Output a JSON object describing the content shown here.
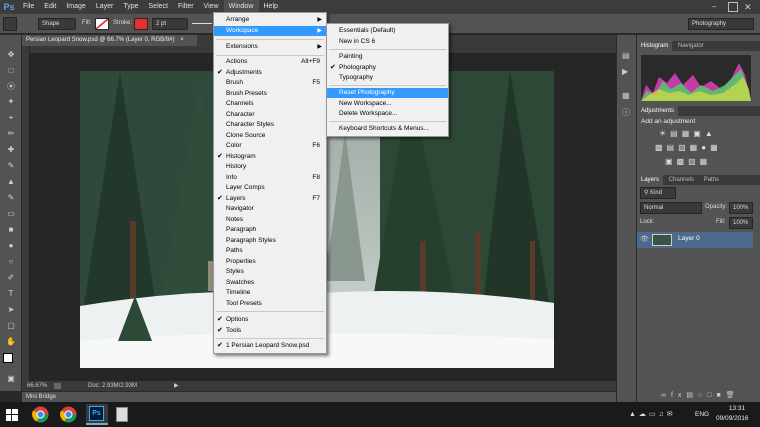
{
  "menubar": {
    "logo": "Ps",
    "items": [
      "File",
      "Edit",
      "Image",
      "Layer",
      "Type",
      "Select",
      "Filter",
      "View",
      "Window",
      "Help"
    ]
  },
  "options": {
    "shape_mode": "Shape",
    "fill_label": "Fill:",
    "stroke_label": "Stroke:",
    "stroke_size": "2 pt",
    "stroke_color": "#e63030",
    "workspace_select": "Photography"
  },
  "document": {
    "tab_title": "Persian Leopard Snow.psd @ 66.7% (Layer 0, RGB/8#)",
    "zoom": "66.67%",
    "doc_size": "Doc: 2.93M/2.93M",
    "mini_bridge": "Mini Bridge"
  },
  "window_menu": {
    "items": [
      {
        "label": "Arrange",
        "check": false,
        "shortcut": "",
        "submenu": true
      },
      {
        "label": "Workspace",
        "check": false,
        "shortcut": "",
        "submenu": true,
        "highlight": true
      },
      {
        "label": "Extensions",
        "check": false,
        "shortcut": "",
        "submenu": true
      },
      {
        "label": "Actions",
        "check": false,
        "shortcut": "Alt+F9"
      },
      {
        "label": "Adjustments",
        "check": true,
        "shortcut": ""
      },
      {
        "label": "Brush",
        "check": false,
        "shortcut": "F5"
      },
      {
        "label": "Brush Presets",
        "check": false,
        "shortcut": ""
      },
      {
        "label": "Channels",
        "check": false,
        "shortcut": ""
      },
      {
        "label": "Character",
        "check": false,
        "shortcut": ""
      },
      {
        "label": "Character Styles",
        "check": false,
        "shortcut": ""
      },
      {
        "label": "Clone Source",
        "check": false,
        "shortcut": ""
      },
      {
        "label": "Color",
        "check": false,
        "shortcut": "F6"
      },
      {
        "label": "Histogram",
        "check": true,
        "shortcut": ""
      },
      {
        "label": "History",
        "check": false,
        "shortcut": ""
      },
      {
        "label": "Info",
        "check": false,
        "shortcut": "F8"
      },
      {
        "label": "Layer Comps",
        "check": false,
        "shortcut": ""
      },
      {
        "label": "Layers",
        "check": true,
        "shortcut": "F7"
      },
      {
        "label": "Navigator",
        "check": false,
        "shortcut": ""
      },
      {
        "label": "Notes",
        "check": false,
        "shortcut": ""
      },
      {
        "label": "Paragraph",
        "check": false,
        "shortcut": ""
      },
      {
        "label": "Paragraph Styles",
        "check": false,
        "shortcut": ""
      },
      {
        "label": "Paths",
        "check": false,
        "shortcut": ""
      },
      {
        "label": "Properties",
        "check": false,
        "shortcut": ""
      },
      {
        "label": "Styles",
        "check": false,
        "shortcut": ""
      },
      {
        "label": "Swatches",
        "check": false,
        "shortcut": ""
      },
      {
        "label": "Timeline",
        "check": false,
        "shortcut": ""
      },
      {
        "label": "Tool Presets",
        "check": false,
        "shortcut": ""
      },
      {
        "label": "Options",
        "check": true,
        "shortcut": ""
      },
      {
        "label": "Tools",
        "check": true,
        "shortcut": ""
      },
      {
        "label": "1 Persian Leopard Snow.psd",
        "check": true,
        "shortcut": ""
      }
    ]
  },
  "workspace_menu": {
    "items": [
      {
        "label": "Essentials (Default)",
        "check": false
      },
      {
        "label": "New in CS 6",
        "check": false
      },
      {
        "label": "Painting",
        "check": false
      },
      {
        "label": "Photography",
        "check": true
      },
      {
        "label": "Typography",
        "check": false
      },
      {
        "label": "Reset Photography",
        "check": false,
        "highlight": true
      },
      {
        "label": "New Workspace...",
        "check": false
      },
      {
        "label": "Delete Workspace...",
        "check": false
      },
      {
        "label": "Keyboard Shortcuts & Menus...",
        "check": false
      }
    ]
  },
  "panels": {
    "histogram_tabs": [
      "Histogram",
      "Navigator"
    ],
    "adjustments_tab": "Adjustments",
    "adjustments_title": "Add an adjustment",
    "layers_tabs": [
      "Layers",
      "Channels",
      "Paths"
    ],
    "kind_label": "Kind",
    "blend_mode": "Normal",
    "opacity_label": "Opacity:",
    "opacity_value": "100%",
    "lock_label": "Lock:",
    "fill_label": "Fill:",
    "fill_value": "100%",
    "layer_name": "Layer 0"
  },
  "taskbar": {
    "lang": "ENG",
    "time": "13:31",
    "date": "09/09/2016"
  }
}
